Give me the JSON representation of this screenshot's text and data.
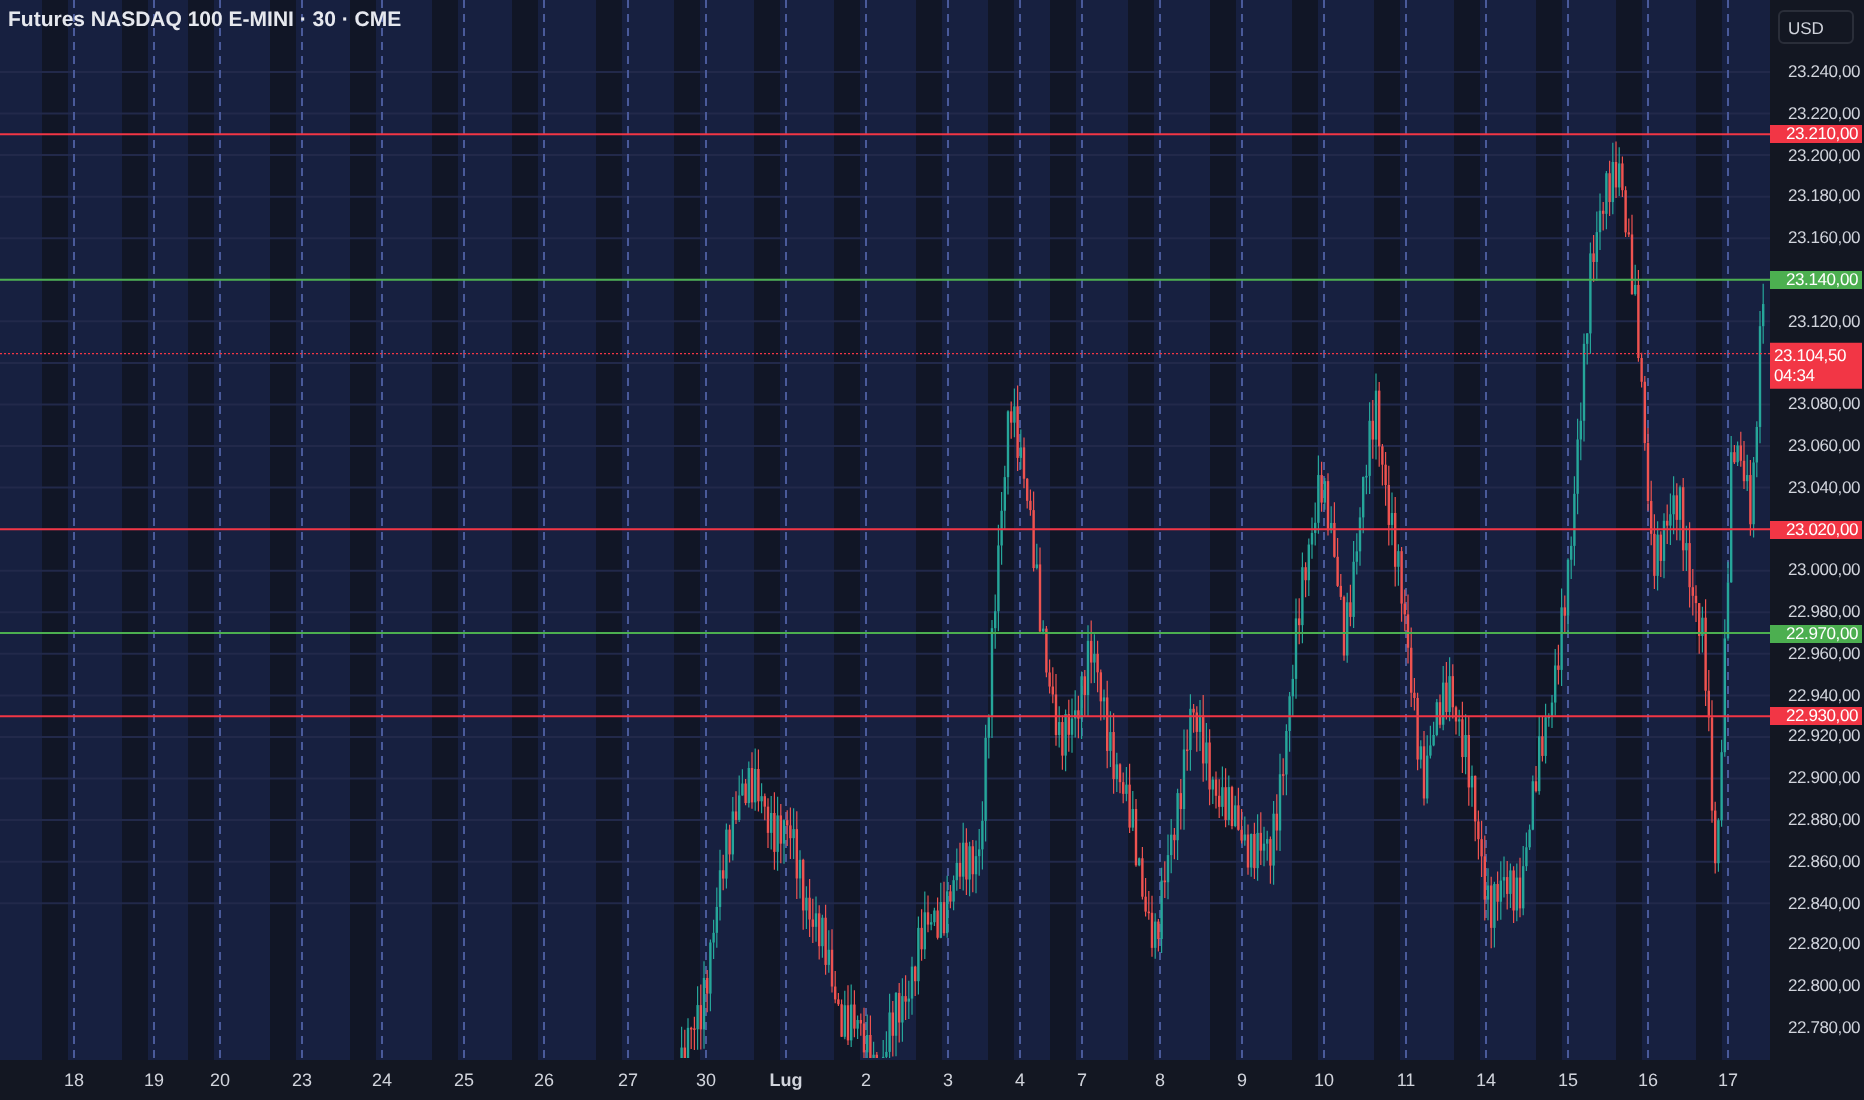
{
  "title": "Futures NASDAQ 100 E-MINI · 30 · CME",
  "currency": "USD",
  "price_ticks": [
    "23.240,00",
    "23.220,00",
    "23.200,00",
    "23.180,00",
    "23.160,00",
    "23.120,00",
    "23.080,00",
    "23.060,00",
    "23.040,00",
    "23.000,00",
    "22.980,00",
    "22.960,00",
    "22.940,00",
    "22.920,00",
    "22.900,00",
    "22.880,00",
    "22.860,00",
    "22.840,00",
    "22.820,00",
    "22.800,00",
    "22.780,00"
  ],
  "levels": [
    {
      "label": "23.210,00",
      "color": "#f23645"
    },
    {
      "label": "23.140,00",
      "color": "#4caf50"
    },
    {
      "label": "23.020,00",
      "color": "#f23645"
    },
    {
      "label": "22.970,00",
      "color": "#4caf50"
    },
    {
      "label": "22.930,00",
      "color": "#f23645"
    }
  ],
  "last_price": {
    "label": "23.104,50",
    "countdown": "04:34"
  },
  "time_labels": [
    {
      "label": "18",
      "kind": "day"
    },
    {
      "label": "19",
      "kind": "day"
    },
    {
      "label": "20",
      "kind": "day"
    },
    {
      "label": "23",
      "kind": "day"
    },
    {
      "label": "24",
      "kind": "day"
    },
    {
      "label": "25",
      "kind": "day"
    },
    {
      "label": "26",
      "kind": "day"
    },
    {
      "label": "27",
      "kind": "day"
    },
    {
      "label": "30",
      "kind": "day"
    },
    {
      "label": "Lug",
      "kind": "month"
    },
    {
      "label": "2",
      "kind": "day"
    },
    {
      "label": "3",
      "kind": "day"
    },
    {
      "label": "4",
      "kind": "day"
    },
    {
      "label": "7",
      "kind": "day"
    },
    {
      "label": "8",
      "kind": "day"
    },
    {
      "label": "9",
      "kind": "day"
    },
    {
      "label": "10",
      "kind": "day"
    },
    {
      "label": "11",
      "kind": "day"
    },
    {
      "label": "14",
      "kind": "day"
    },
    {
      "label": "15",
      "kind": "day"
    },
    {
      "label": "16",
      "kind": "day"
    },
    {
      "label": "17",
      "kind": "day"
    }
  ]
}
